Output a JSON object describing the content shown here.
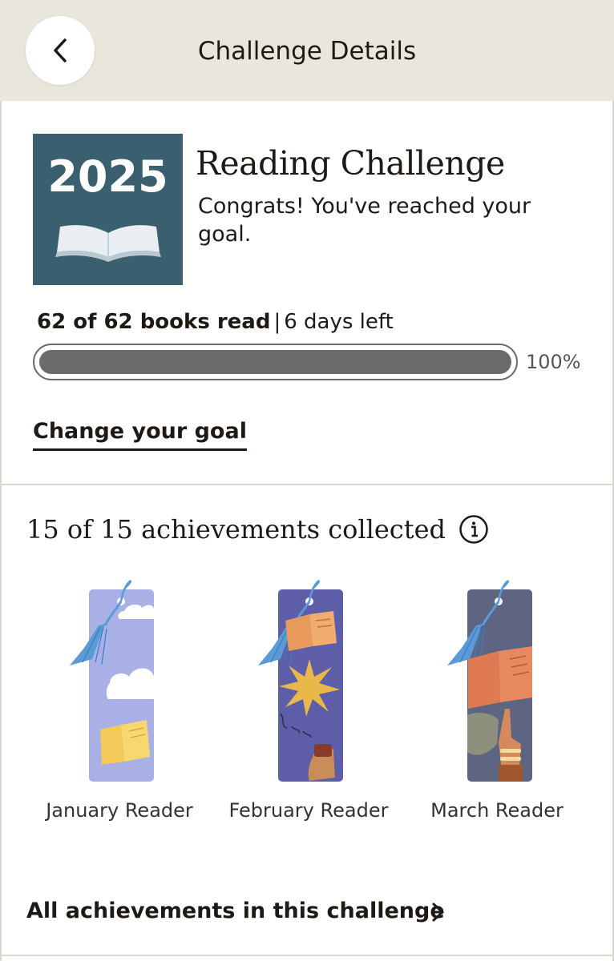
{
  "header": {
    "title": "Challenge Details",
    "back_icon": "chevron-left-icon"
  },
  "challenge": {
    "year": "2025",
    "title": "Reading Challenge",
    "message": "Congrats! You've reached your goal.",
    "books_read_label": "62 of 62 books read",
    "days_left_label": "6 days left",
    "progress_fraction": 1.0,
    "progress_percent_label": "100%",
    "change_goal_label": "Change your goal"
  },
  "achievements": {
    "title": "15 of 15 achievements collected",
    "info_icon": "info-icon",
    "items": [
      {
        "label": "January Reader",
        "badge": "january-bookmark"
      },
      {
        "label": "February Reader",
        "badge": "february-bookmark"
      },
      {
        "label": "March Reader",
        "badge": "march-bookmark"
      }
    ],
    "all_label": "All achievements in this challenge",
    "all_icon": "chevron-right-icon"
  },
  "colors": {
    "header_bg": "#e9e7dc",
    "badge_bg": "#3a5f6e",
    "progress_fill": "#6b6b6b",
    "text": "#1e1915",
    "tassel": "#5b9bd5"
  }
}
